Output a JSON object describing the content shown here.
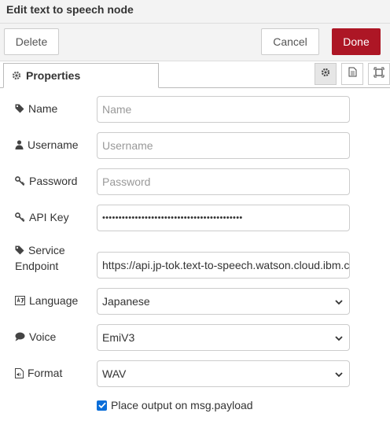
{
  "dialog": {
    "title": "Edit text to speech node"
  },
  "actions": {
    "delete_label": "Delete",
    "cancel_label": "Cancel",
    "done_label": "Done"
  },
  "tabs": {
    "properties_label": "Properties"
  },
  "icons": {
    "tab": "gear-icon",
    "tools": [
      "gear-icon",
      "document-icon",
      "frame-icon"
    ]
  },
  "fields": {
    "name": {
      "label": "Name",
      "placeholder": "Name",
      "value": ""
    },
    "username": {
      "label": "Username",
      "placeholder": "Username",
      "value": ""
    },
    "password": {
      "label": "Password",
      "placeholder": "Password",
      "value": ""
    },
    "apikey": {
      "label": "API Key",
      "value": "•••••••••••••••••••••••••••••••••••••••••••"
    },
    "endpoint": {
      "label_line1": "Service",
      "label_line2": "Endpoint",
      "value": "https://api.jp-tok.text-to-speech.watson.cloud.ibm.com"
    },
    "language": {
      "label": "Language",
      "value": "Japanese"
    },
    "voice": {
      "label": "Voice",
      "value": "EmiV3"
    },
    "format": {
      "label": "Format",
      "value": "WAV"
    }
  },
  "checkbox": {
    "label": "Place output on msg.payload",
    "checked": true
  },
  "colors": {
    "done_bg": "#ad1625",
    "checkbox_bg": "#0b6ed9"
  }
}
